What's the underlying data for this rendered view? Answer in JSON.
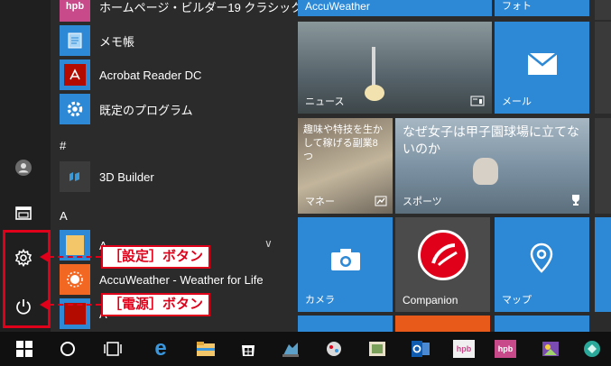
{
  "apps": {
    "homepage_builder": "ホームページ・ビルダー19 クラシック",
    "notepad": "メモ帳",
    "acrobat": "Acrobat Reader DC",
    "default_programs": "既定のプログラム",
    "group_hash": "#",
    "builder3d": "3D Builder",
    "group_a": "A",
    "accuweather_list": "AccuWeather - Weather for Life",
    "partial_a1": "A",
    "partial_a2": "A"
  },
  "callouts": {
    "settings": "［設定］ボタン",
    "power": "［電源］ボタン"
  },
  "tiles": {
    "accuweather": "AccuWeather",
    "photos": "フォト",
    "news": "ニュース",
    "mail": "メール",
    "money_headline": "趣味や特技を生かして稼げる副業8つ",
    "money": "マネー",
    "sports_headline": "なぜ女子は甲子園球場に立てないのか",
    "sports": "スポーツ",
    "camera": "カメラ",
    "companion": "Companion",
    "maps": "マップ"
  },
  "colors": {
    "tile_blue": "#2d89d6",
    "tile_grey": "#4b4b4b",
    "highlight_red": "#e0001a",
    "taskbar": "#101010"
  },
  "icons": {
    "rail": [
      "user-icon",
      "documents-icon",
      "settings-gear-icon",
      "power-icon"
    ],
    "taskbar": [
      "windows-start-icon",
      "cortana-circle-icon",
      "task-view-icon",
      "edge-icon",
      "file-explorer-icon",
      "store-icon",
      "app-icon-1",
      "app-icon-2",
      "app-icon-3",
      "outlook-icon",
      "hpb-icon-1",
      "hpb-icon-2",
      "app-icon-4",
      "app-icon-5"
    ]
  }
}
